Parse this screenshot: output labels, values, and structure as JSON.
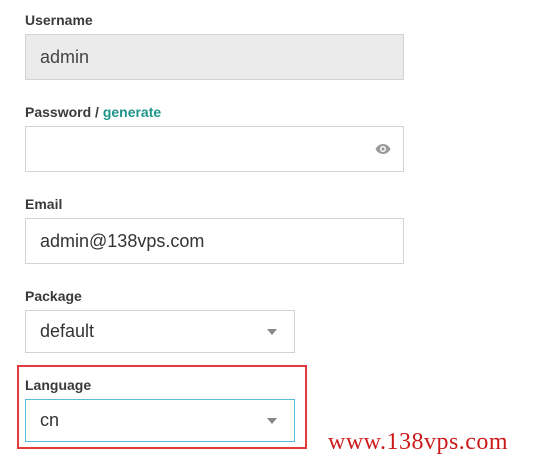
{
  "username": {
    "label": "Username",
    "value": "admin"
  },
  "password": {
    "label": "Password",
    "separator": " / ",
    "generate_link": "generate",
    "value": "",
    "toggle_icon": "eye-icon"
  },
  "email": {
    "label": "Email",
    "value": "admin@138vps.com"
  },
  "package": {
    "label": "Package",
    "selected": "default",
    "dropdown_icon": "caret-down-icon"
  },
  "language": {
    "label": "Language",
    "selected": "cn",
    "dropdown_icon": "caret-down-icon"
  },
  "watermark": "www.138vps.com",
  "colors": {
    "link": "#1e9588",
    "highlight_border": "#e23b3b",
    "watermark": "#cc1a1a",
    "focused_border": "#5bbcd6",
    "disabled_bg": "#ebebeb"
  }
}
